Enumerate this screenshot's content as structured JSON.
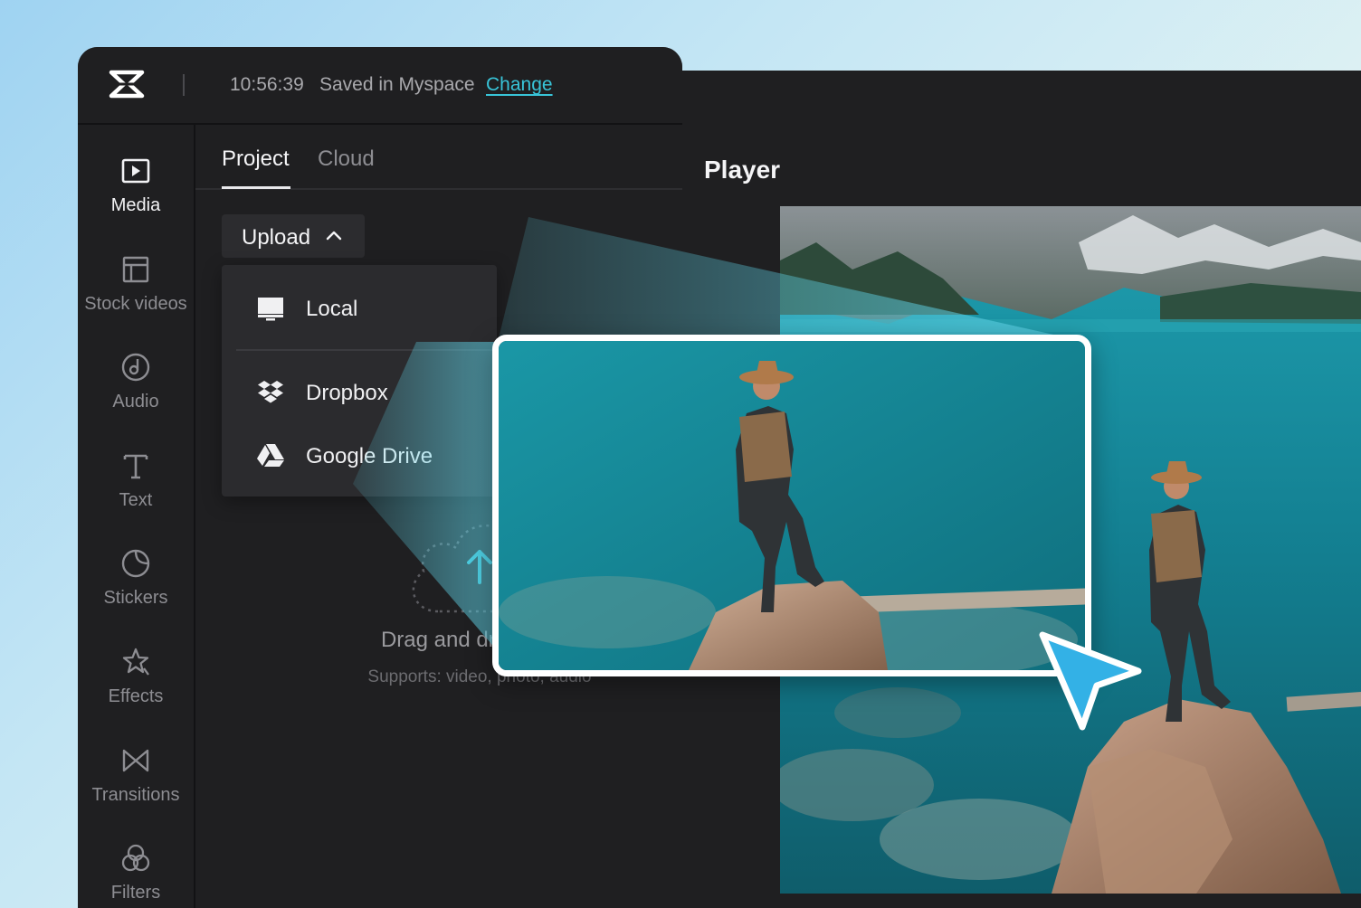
{
  "header": {
    "time": "10:56:39",
    "saved_text": "Saved in Myspace",
    "change_link": "Change",
    "logo_icon": "capcut-logo-icon"
  },
  "sidebar": {
    "items": [
      {
        "label": "Media",
        "icon": "media-play-icon",
        "active": true
      },
      {
        "label": "Stock videos",
        "icon": "stock-videos-icon",
        "active": false
      },
      {
        "label": "Audio",
        "icon": "audio-icon",
        "active": false
      },
      {
        "label": "Text",
        "icon": "text-icon",
        "active": false
      },
      {
        "label": "Stickers",
        "icon": "stickers-icon",
        "active": false
      },
      {
        "label": "Effects",
        "icon": "effects-icon",
        "active": false
      },
      {
        "label": "Transitions",
        "icon": "transitions-icon",
        "active": false
      },
      {
        "label": "Filters",
        "icon": "filters-icon",
        "active": false
      }
    ]
  },
  "tabs": [
    {
      "label": "Project",
      "active": true
    },
    {
      "label": "Cloud",
      "active": false
    }
  ],
  "upload": {
    "label": "Upload",
    "menu": [
      {
        "label": "Local",
        "icon": "monitor-icon"
      },
      {
        "label": "Dropbox",
        "icon": "dropbox-icon"
      },
      {
        "label": "Google Drive",
        "icon": "google-drive-icon"
      }
    ]
  },
  "dropzone": {
    "title": "Drag and drop files f",
    "subtitle": "Supports: video, photo, audio"
  },
  "player": {
    "title": "Player"
  },
  "colors": {
    "accent": "#38c4d8",
    "panel": "#1f1f21",
    "cursor": "#33b1e6"
  }
}
